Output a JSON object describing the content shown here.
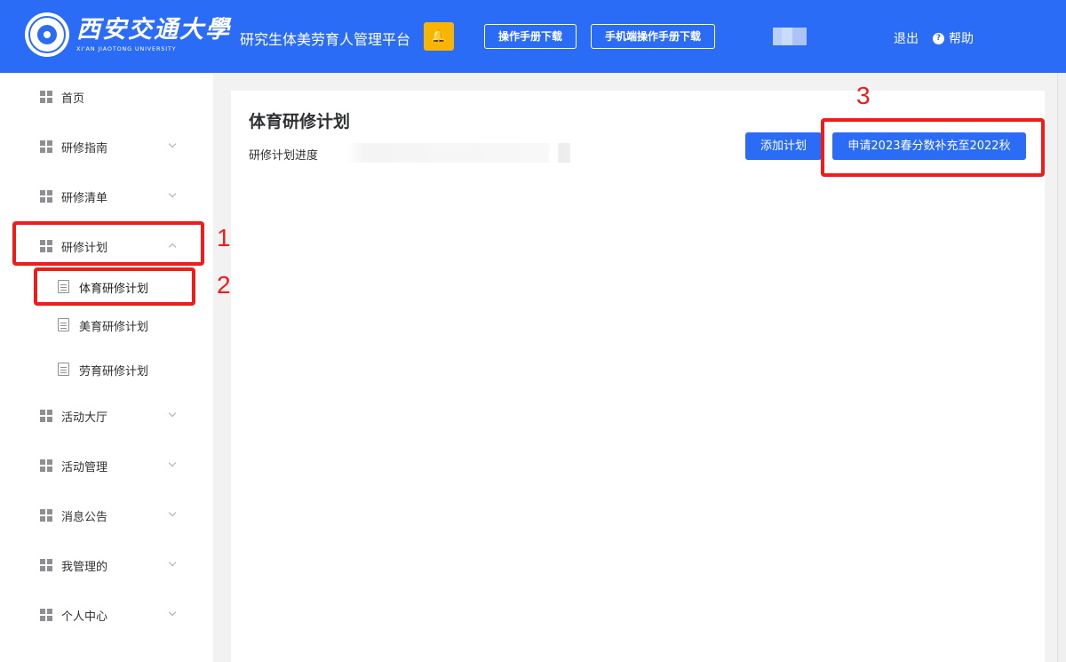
{
  "header": {
    "logo_cn": "西安交通大學",
    "logo_en": "XI'AN JIAOTONG UNIVERSITY",
    "platform_title": "研究生体美劳育人管理平台",
    "manual_button": "操作手册下载",
    "mobile_manual_button": "手机端操作手册下载",
    "logout": "退出",
    "help": "帮助",
    "help_icon_glyph": "?",
    "bell_glyph": "🔔"
  },
  "sidebar": {
    "items": [
      {
        "label": "首页",
        "expandable": false
      },
      {
        "label": "研修指南",
        "expandable": true
      },
      {
        "label": "研修清单",
        "expandable": true
      },
      {
        "label": "研修计划",
        "expandable": true,
        "expanded": true
      },
      {
        "label": "活动大厅",
        "expandable": true
      },
      {
        "label": "活动管理",
        "expandable": true
      },
      {
        "label": "消息公告",
        "expandable": true
      },
      {
        "label": "我管理的",
        "expandable": true
      },
      {
        "label": "个人中心",
        "expandable": true
      }
    ],
    "sub_items": [
      {
        "label": "体育研修计划",
        "active": true
      },
      {
        "label": "美育研修计划",
        "active": false
      },
      {
        "label": "劳育研修计划",
        "active": false
      }
    ]
  },
  "main": {
    "title": "体育研修计划",
    "progress_label": "研修计划进度",
    "add_button": "添加计划",
    "apply_button": "申请2023春分数补充至2022秋"
  },
  "annotations": [
    "1",
    "2",
    "3"
  ],
  "colors": {
    "primary": "#2a6cf6",
    "bell": "#f7b500",
    "annotation": "#ef1c1c"
  }
}
